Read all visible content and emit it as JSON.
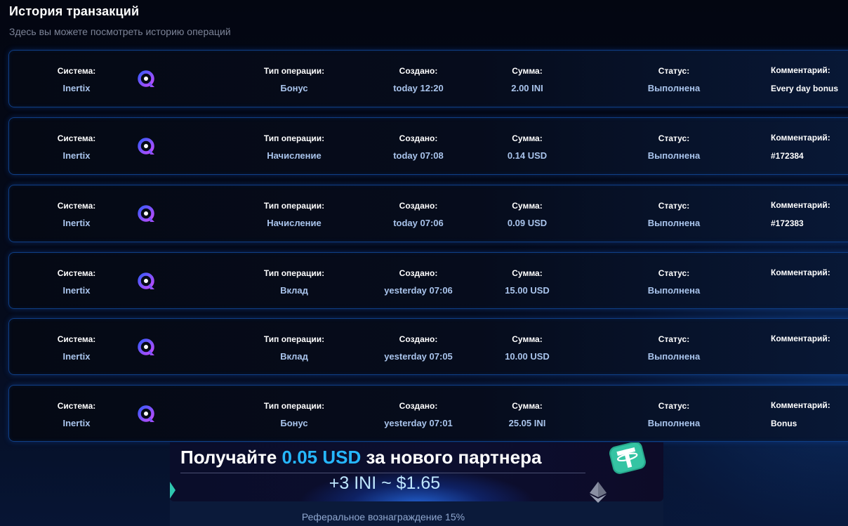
{
  "header": {
    "title": "История транзакций",
    "subtitle": "Здесь вы можете посмотреть историю операций"
  },
  "labels": {
    "system": "Система:",
    "type": "Тип операции:",
    "created": "Создано:",
    "amount": "Сумма:",
    "status": "Статус:",
    "comment": "Комментарий:"
  },
  "transactions": [
    {
      "system": "Inertix",
      "system_icon": "inertix-logo-icon",
      "type": "Бонус",
      "created": "today 12:20",
      "amount": "2.00 INI",
      "status": "Выполнена",
      "comment": "Every day bonus"
    },
    {
      "system": "Inertix",
      "system_icon": "inertix-logo-icon",
      "type": "Начисление",
      "created": "today 07:08",
      "amount": "0.14 USD",
      "status": "Выполнена",
      "comment": "#172384"
    },
    {
      "system": "Inertix",
      "system_icon": "inertix-logo-icon",
      "type": "Начисление",
      "created": "today 07:06",
      "amount": "0.09 USD",
      "status": "Выполнена",
      "comment": "#172383"
    },
    {
      "system": "Inertix",
      "system_icon": "inertix-logo-icon",
      "type": "Вклад",
      "created": "yesterday 07:06",
      "amount": "15.00 USD",
      "status": "Выполнена",
      "comment": ""
    },
    {
      "system": "Inertix",
      "system_icon": "inertix-logo-icon",
      "type": "Вклад",
      "created": "yesterday 07:05",
      "amount": "10.00 USD",
      "status": "Выполнена",
      "comment": ""
    },
    {
      "system": "Inertix",
      "system_icon": "inertix-logo-icon",
      "type": "Бонус",
      "created": "yesterday 07:01",
      "amount": "25.05 INI",
      "status": "Выполнена",
      "comment": "Bonus"
    }
  ],
  "banner": {
    "headline_prefix": "Получайте",
    "headline_amount": "0.05 USD",
    "headline_suffix": "за нового партнера",
    "reward": "+3 INI ~ $1.65",
    "footer": "Реферальное вознаграждение 15%",
    "icons": [
      "tether-coin-icon",
      "ethereum-icon"
    ]
  },
  "colors": {
    "background": "#03060f",
    "row_border": "#0f3f86",
    "value_text": "#a9c4ec",
    "accent": "#26b7ff",
    "logo_gradient_start": "#3b5bff",
    "logo_gradient_end": "#c04bff"
  }
}
